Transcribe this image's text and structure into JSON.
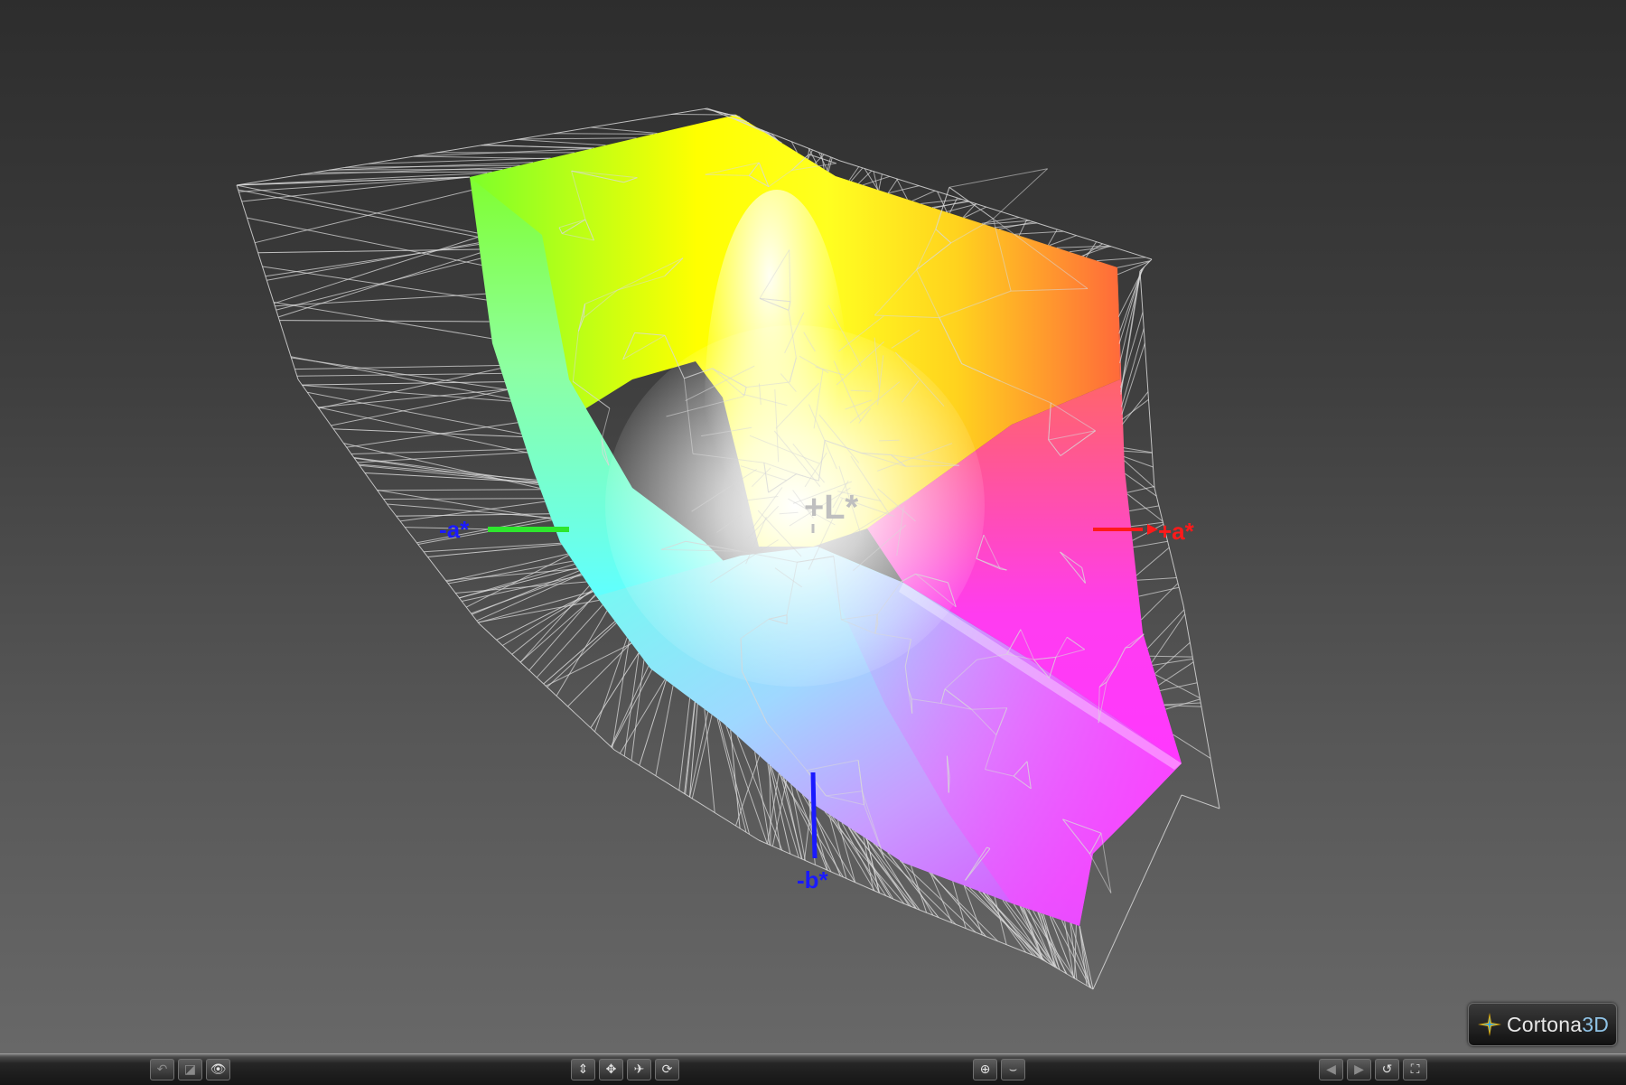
{
  "viewer": {
    "axes": {
      "plus_l": "+L*",
      "plus_a": "+a*",
      "minus_a": "-a*",
      "minus_b": "-b*"
    },
    "colors": {
      "axis_a_positive": "#ff1a1a",
      "axis_a_negative": "#2ee62e",
      "axis_b": "#1a1aff",
      "axis_l": "#bfbfbf",
      "wireframe": "#d8d8d8"
    }
  },
  "logo": {
    "name": "Cortona",
    "suffix": "3D"
  },
  "toolbar": {
    "left_group": [
      {
        "icon": "navigate-back-icon"
      },
      {
        "icon": "camera-icon"
      },
      {
        "icon": "eye-icon"
      }
    ],
    "center_group": [
      {
        "icon": "walk-icon"
      },
      {
        "icon": "pan-icon"
      },
      {
        "icon": "fly-icon"
      },
      {
        "icon": "rotate-icon"
      }
    ],
    "right_center_group": [
      {
        "icon": "target-icon"
      },
      {
        "icon": "align-icon"
      }
    ],
    "right_group": [
      {
        "icon": "previous-viewpoint-icon"
      },
      {
        "icon": "next-viewpoint-icon"
      },
      {
        "icon": "restore-view-icon"
      },
      {
        "icon": "fit-view-icon"
      }
    ]
  }
}
